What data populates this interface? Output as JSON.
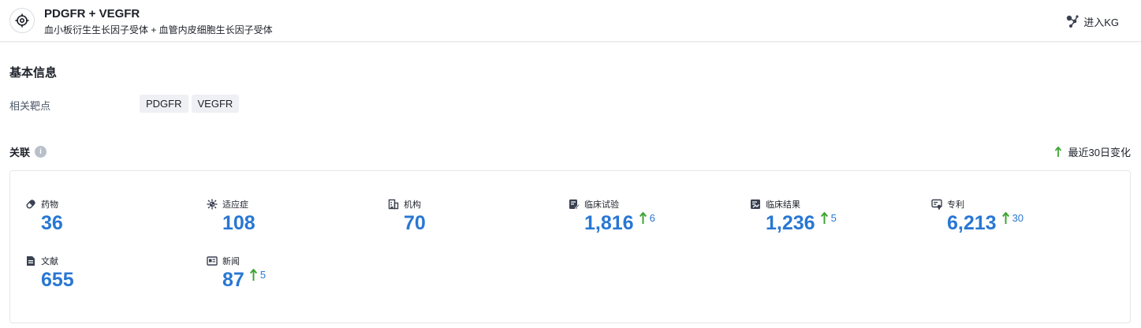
{
  "header": {
    "title": "PDGFR + VEGFR",
    "subtitle": "血小板衍生生长因子受体 + 血管内皮细胞生长因子受体",
    "kg_button": "进入KG",
    "icons": {
      "target": "crosshair-target-icon",
      "kg": "graph-nodes-icon"
    }
  },
  "basic_info": {
    "title": "基本信息",
    "related_targets_label": "相关靶点",
    "targets": [
      "PDGFR",
      "VEGFR"
    ]
  },
  "related": {
    "title": "关联",
    "recent_change_label": "最近30日变化",
    "colors": {
      "value": "#2877d3",
      "up_arrow": "#3fa535"
    },
    "stats": [
      {
        "label": "药物",
        "value": "36",
        "delta": "",
        "icon": "pill-icon"
      },
      {
        "label": "适应症",
        "value": "108",
        "delta": "",
        "icon": "virus-icon"
      },
      {
        "label": "机构",
        "value": "70",
        "delta": "",
        "icon": "building-icon"
      },
      {
        "label": "临床试验",
        "value": "1,816",
        "delta": "6",
        "icon": "clinical-trial-icon"
      },
      {
        "label": "临床结果",
        "value": "1,236",
        "delta": "5",
        "icon": "clinical-result-icon"
      },
      {
        "label": "专利",
        "value": "6,213",
        "delta": "30",
        "icon": "patent-icon"
      },
      {
        "label": "文献",
        "value": "655",
        "delta": "",
        "icon": "document-icon"
      },
      {
        "label": "新闻",
        "value": "87",
        "delta": "5",
        "icon": "news-icon"
      }
    ]
  }
}
